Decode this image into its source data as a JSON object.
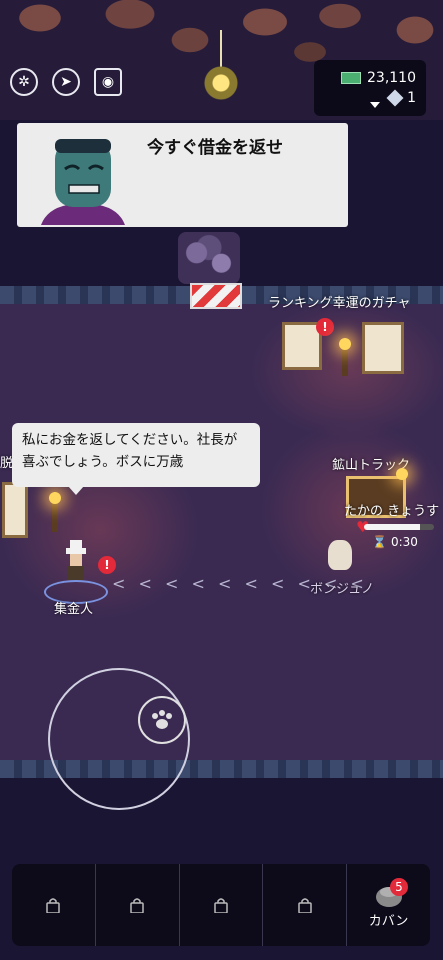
{
  "hud": {
    "cash": "23,110",
    "gems": "1",
    "icons": [
      "compass-icon",
      "cursor-icon",
      "camera-icon",
      "lamp-icon",
      "cash-icon",
      "gem-icon"
    ]
  },
  "dialog": {
    "text": "今すぐ借金を返せ"
  },
  "map": {
    "ranking_label": "ランキング",
    "gacha_label": "幸運のガチャ",
    "mine_label": "鉱山トラック",
    "npc_partial_label": "脱出"
  },
  "speech": {
    "text": "私にお金を返してください。社長が喜ぶでしょう。ボスに万歳"
  },
  "npc": {
    "name": "集金人",
    "alert": "!"
  },
  "player": {
    "name": "ボンジュノ",
    "speech": "たかの きょうす",
    "timer": "0:30",
    "hp_fraction": 0.8
  },
  "board_alert": "!",
  "bottom_bar": {
    "bag_label": "カバン",
    "bag_badge": "5"
  },
  "colors": {
    "background": "#1b1534",
    "arena": "#3a2a52",
    "alert": "#e22a3a"
  }
}
